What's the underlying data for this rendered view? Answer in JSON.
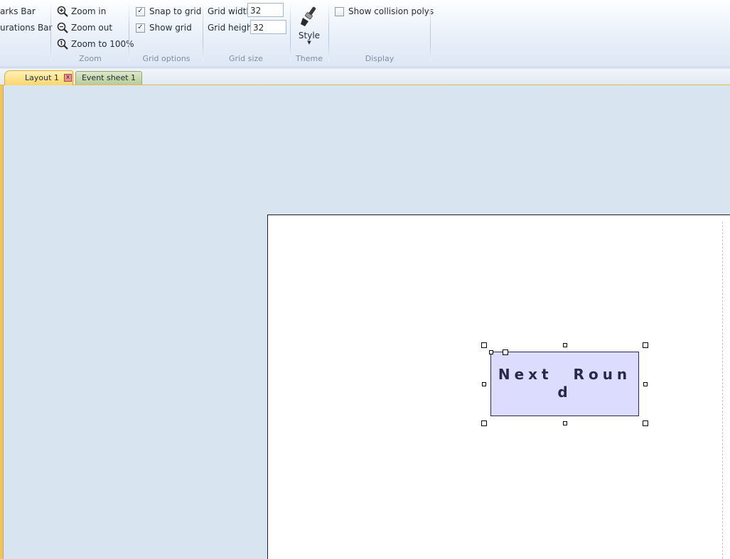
{
  "ribbon": {
    "left_partial": {
      "item1": "arks Bar",
      "item2": "urations Bar"
    },
    "zoom": {
      "zoom_in": "Zoom in",
      "zoom_out": "Zoom out",
      "zoom_100": "Zoom to 100%",
      "group_label": "Zoom"
    },
    "grid_options": {
      "snap_to_grid": "Snap to grid",
      "snap_checked": true,
      "show_grid": "Show grid",
      "show_grid_checked": true,
      "group_label": "Grid options"
    },
    "grid_size": {
      "width_label": "Grid width",
      "width_value": "32",
      "height_label": "Grid height",
      "height_value": "32",
      "group_label": "Grid size"
    },
    "theme": {
      "style_label": "Style",
      "group_label": "Theme"
    },
    "display": {
      "show_collision_polys": "Show collision polys",
      "show_collision_checked": false,
      "group_label": "Display"
    }
  },
  "tabs": [
    {
      "label": "Layout 1",
      "active": true
    },
    {
      "label": "Event sheet 1",
      "active": false
    }
  ],
  "canvas": {
    "sprite_text": "Next Roun d",
    "sprite_line1": "Next Roun",
    "sprite_line2": "d"
  },
  "colors": {
    "active_tab": "#fbd66a",
    "event_tab": "#b9cc97",
    "workspace_bg": "#d9e4f1",
    "sprite_fill": "#dcdcfe"
  }
}
